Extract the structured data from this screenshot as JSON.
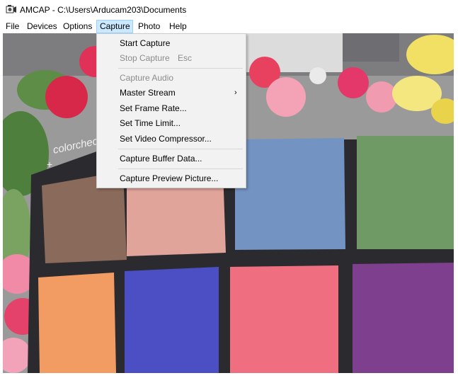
{
  "window": {
    "title": "AMCAP - C:\\Users\\Arducam203\\Documents",
    "icon": "camera-app-icon"
  },
  "menubar": {
    "items": [
      {
        "label": "File"
      },
      {
        "label": "Devices"
      },
      {
        "label": "Options"
      },
      {
        "label": "Capture",
        "active": true
      },
      {
        "label": "Photo"
      },
      {
        "label": "Help"
      }
    ]
  },
  "capture_menu": {
    "start_capture": "Start Capture",
    "stop_capture": "Stop Capture",
    "stop_capture_shortcut": "Esc",
    "capture_audio": "Capture Audio",
    "master_stream": "Master Stream",
    "master_stream_arrow": "›",
    "set_frame_rate": "Set Frame Rate...",
    "set_time_limit": "Set Time Limit...",
    "set_video_compressor": "Set Video Compressor...",
    "capture_buffer_data": "Capture Buffer Data...",
    "capture_preview_picture": "Capture Preview Picture..."
  },
  "preview": {
    "chart_brand": "colorchecker",
    "patch_colors": {
      "row1": [
        "#8a6a5a",
        "#e0a49b",
        "#7393c2",
        "#6f9a66"
      ],
      "row2": [
        "#f29b62",
        "#4b4fc3",
        "#ef6e80",
        "#7e3f8e"
      ]
    },
    "board_color": "#2b2a2e",
    "menu_highlight": "#cce8ff"
  }
}
